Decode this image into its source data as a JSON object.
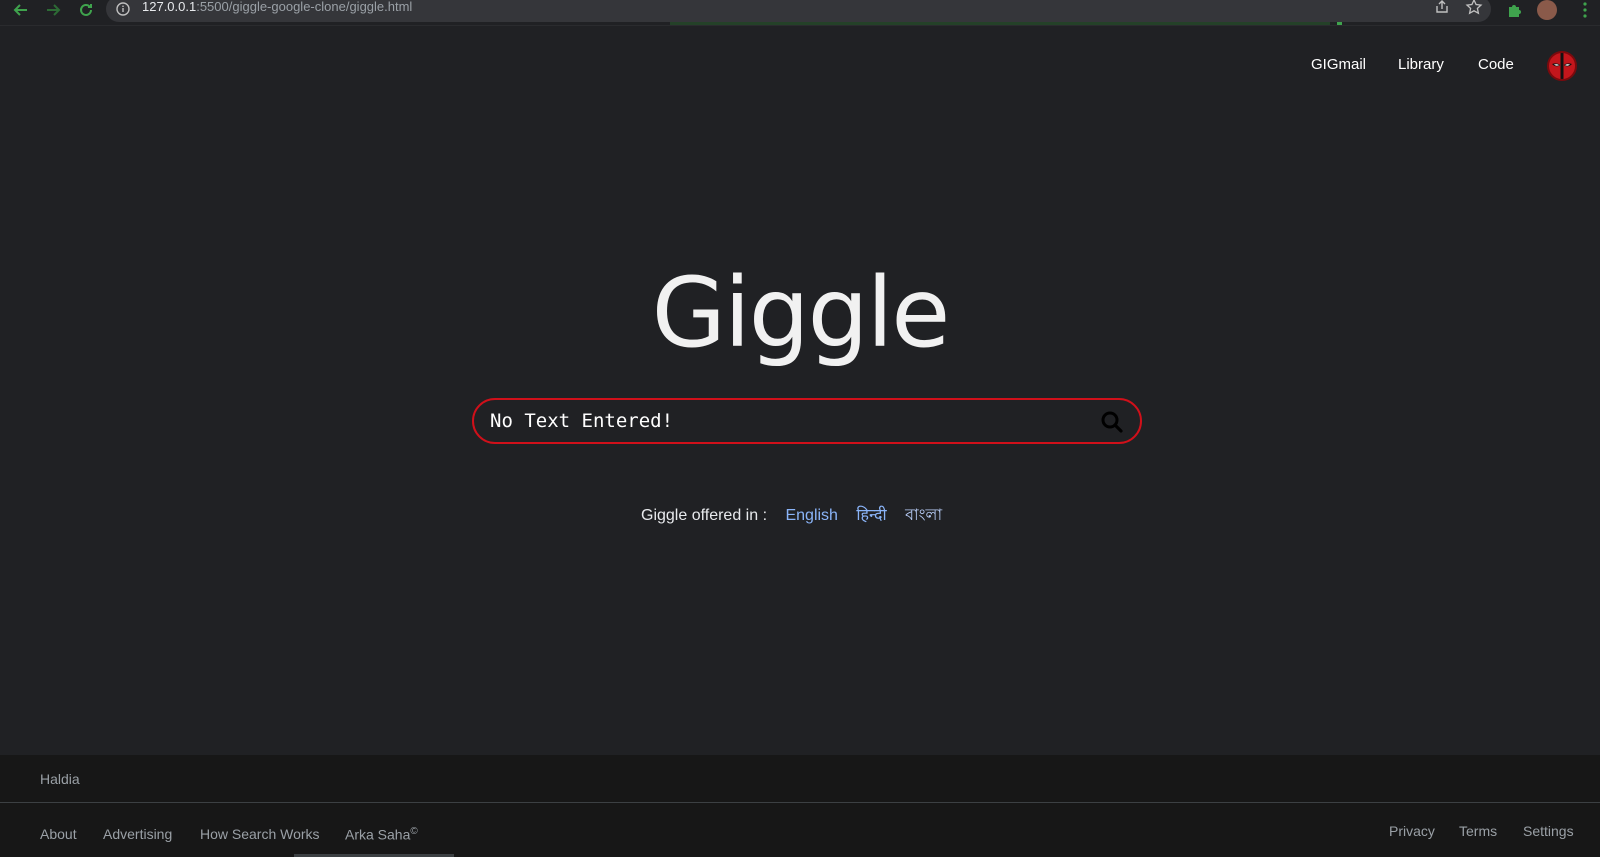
{
  "browser": {
    "url_host": "127.0.0.1",
    "url_rest": ":5500/giggle-google-clone/giggle.html"
  },
  "topnav": {
    "gmail": "GIGmail",
    "library": "Library",
    "code": "Code"
  },
  "logo": "Giggle",
  "search": {
    "placeholder": "No Text Entered!"
  },
  "languages": {
    "label": "Giggle offered in :",
    "english": "English",
    "hindi": "हिन्दी",
    "bengali": "বাংলা"
  },
  "footer": {
    "location": "Haldia",
    "about": "About",
    "advertising": "Advertising",
    "how_search_works": "How Search Works",
    "author": "Arka Saha",
    "copyright": "©",
    "privacy": "Privacy",
    "terms": "Terms",
    "settings": "Settings"
  },
  "colors": {
    "background": "#202124",
    "search_border": "#d0101a",
    "link_blue": "#8ab4f8",
    "footer_bg": "#171717"
  }
}
